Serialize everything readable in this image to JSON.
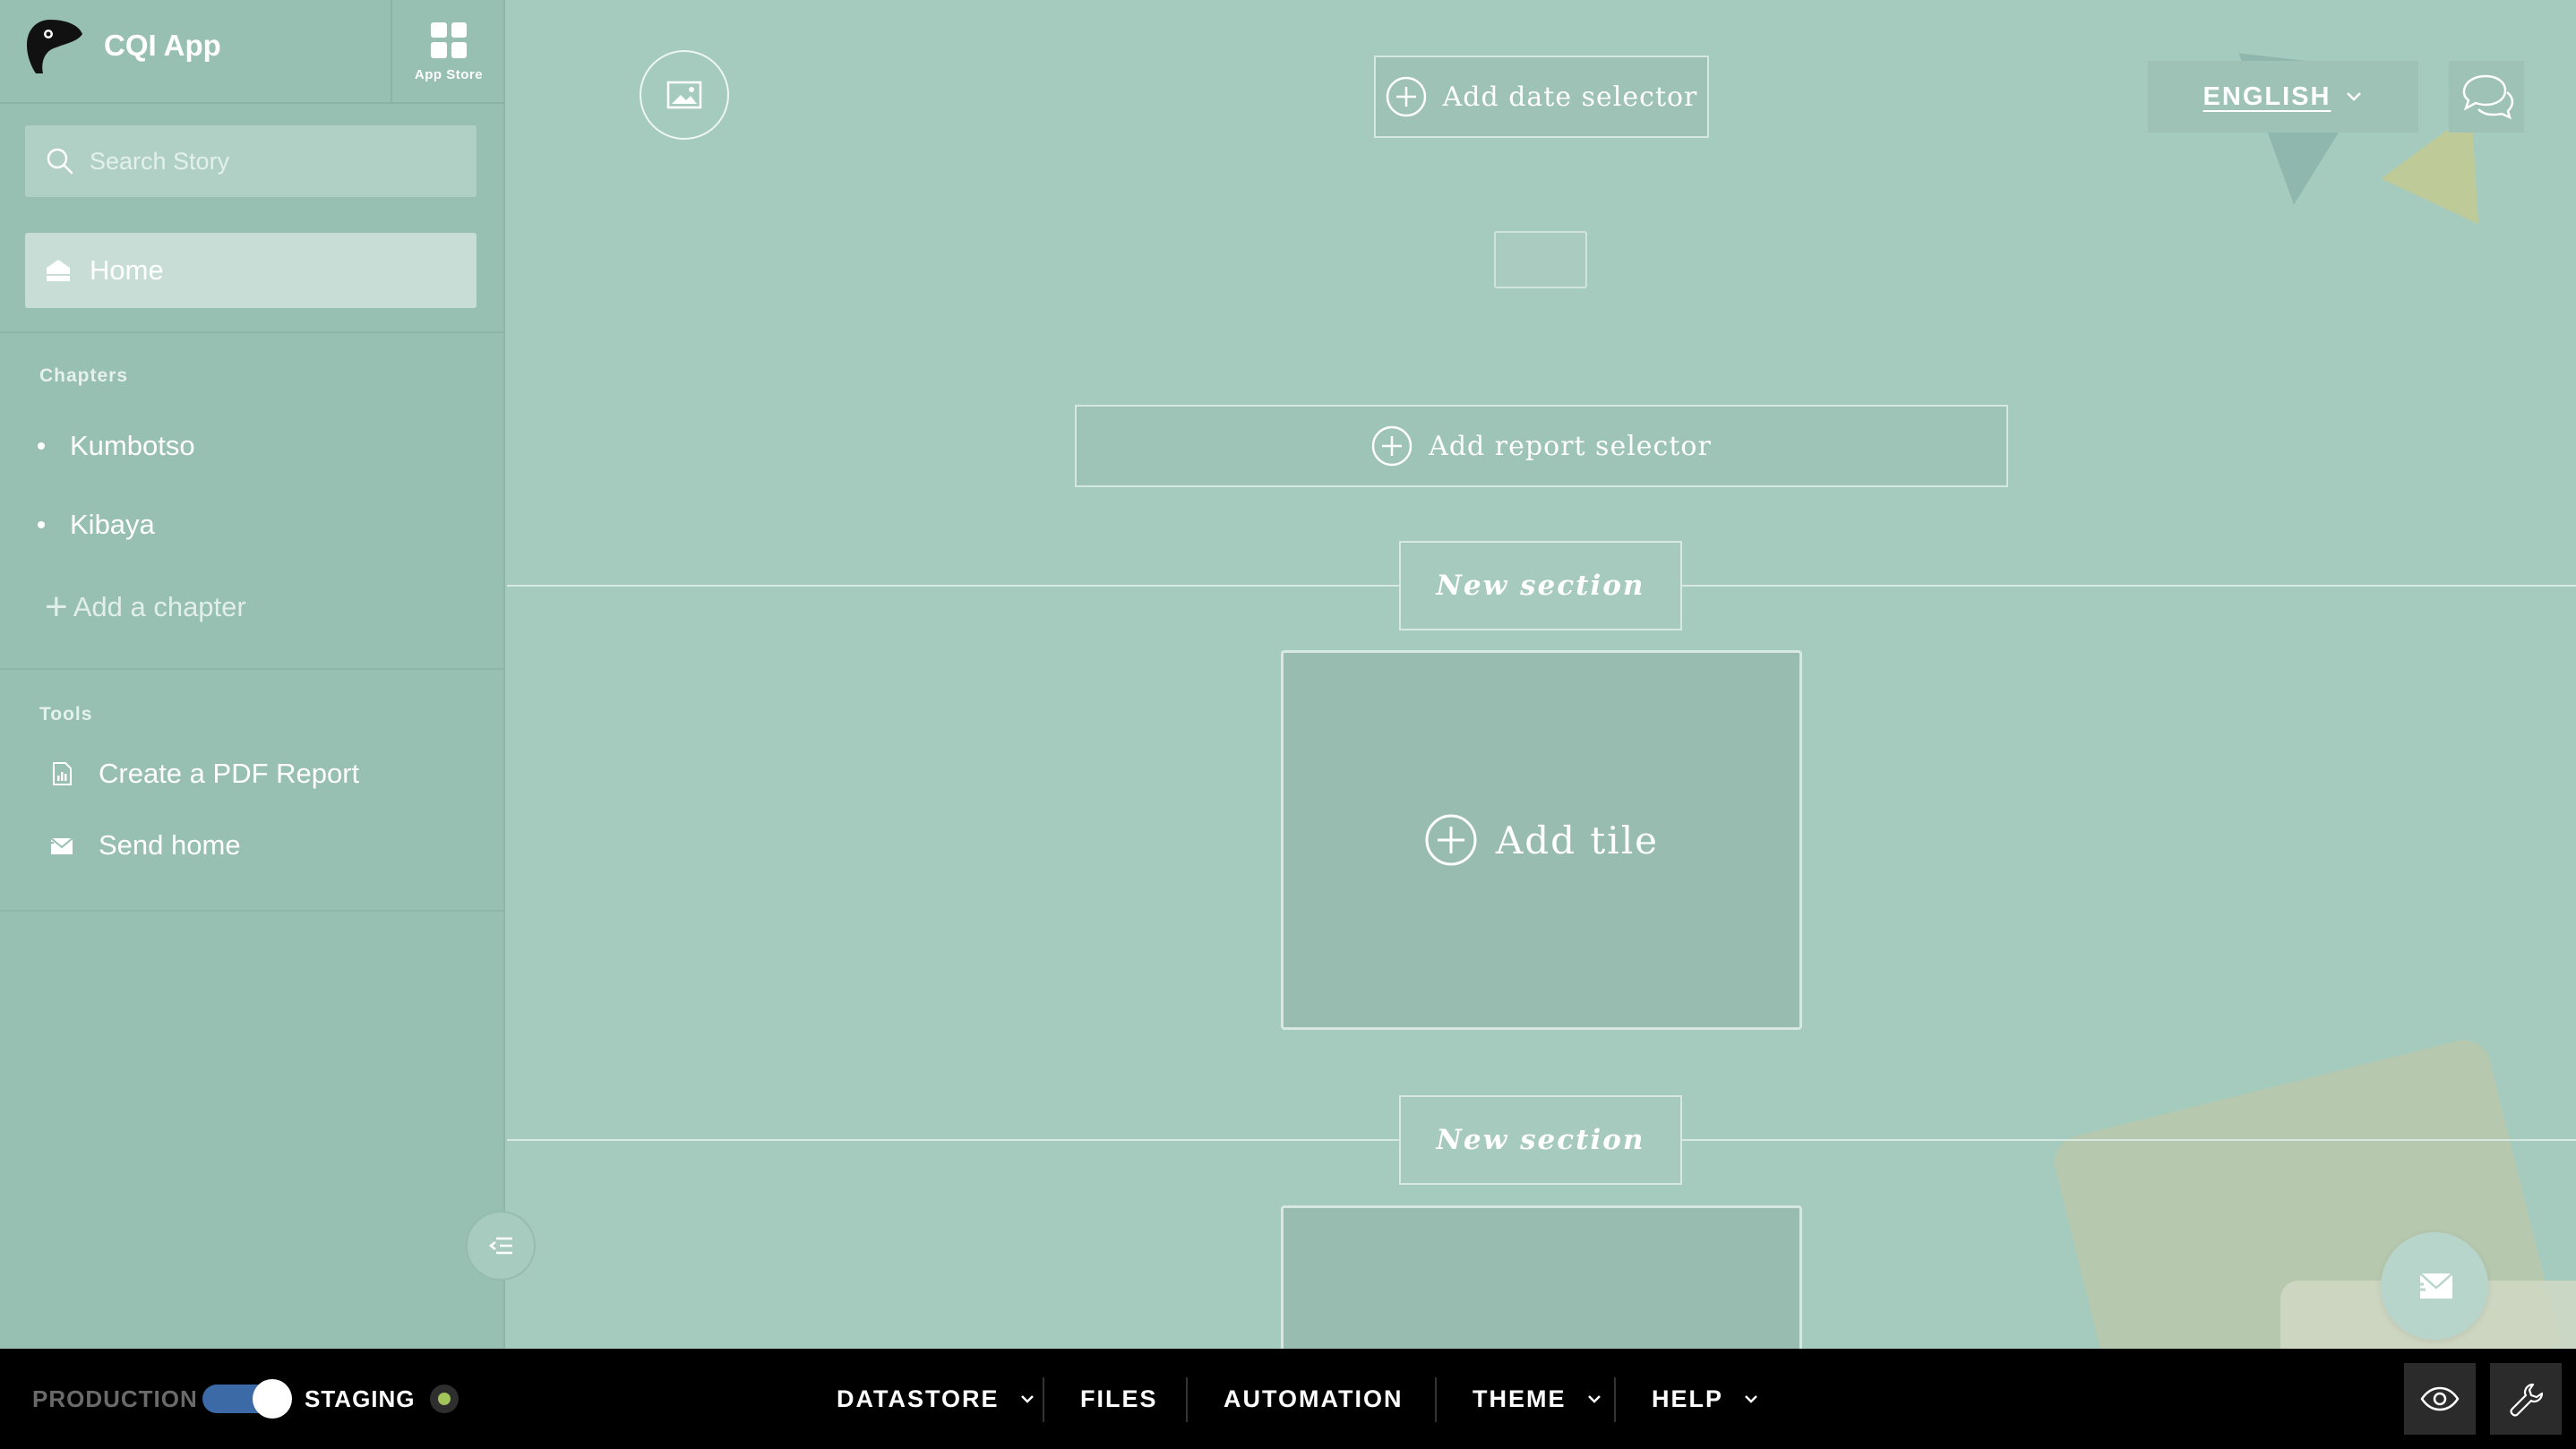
{
  "sidebar": {
    "app_title": "CQI App",
    "app_store_label": "App Store",
    "search_placeholder": "Search Story",
    "home_label": "Home",
    "chapters_heading": "Chapters",
    "chapters": [
      {
        "label": "Kumbotso"
      },
      {
        "label": "Kibaya"
      }
    ],
    "add_chapter_label": "Add a chapter",
    "tools_heading": "Tools",
    "tools": [
      {
        "label": "Create a PDF Report",
        "icon": "pdf-report-icon"
      },
      {
        "label": "Send home",
        "icon": "send-home-icon"
      }
    ]
  },
  "main": {
    "add_date_selector_label": "Add date selector",
    "add_report_selector_label": "Add report selector",
    "language_label": "ENGLISH",
    "sections": [
      {
        "title": "New section",
        "tile_label": "Add tile"
      },
      {
        "title": "New section",
        "tile_label": ""
      }
    ]
  },
  "bottombar": {
    "production_label": "PRODUCTION",
    "staging_label": "STAGING",
    "toggle_state": "staging",
    "menu": [
      {
        "label": "DATASTORE",
        "has_dropdown": true
      },
      {
        "label": "FILES",
        "has_dropdown": false
      },
      {
        "label": "AUTOMATION",
        "has_dropdown": false
      },
      {
        "label": "THEME",
        "has_dropdown": true
      },
      {
        "label": "HELP",
        "has_dropdown": true
      }
    ]
  },
  "colors": {
    "background": "#a5cbbf",
    "sidebar": "#97bfb2",
    "bottombar": "#000000",
    "toggle_accent": "#3b6aa6",
    "status_dot": "#a3c55a"
  }
}
